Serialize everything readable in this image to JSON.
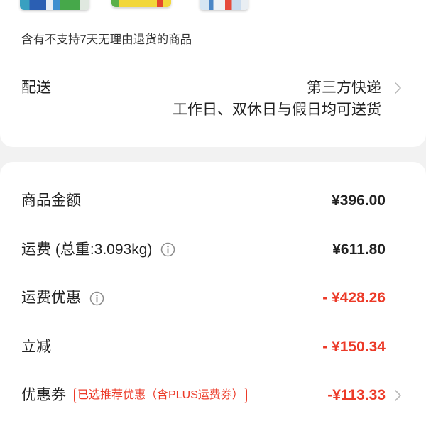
{
  "colors": {
    "accent_red": "#ec3a28",
    "text": "#222222",
    "icon_gray": "#8a8a8a",
    "chevron_gray": "#b8b8b8",
    "page_background": "#f2f2f2",
    "card_background": "#ffffff"
  },
  "products": {
    "notice": "含有不支持7天无理由退货的商品"
  },
  "delivery": {
    "label": "配送",
    "method": "第三方快递",
    "note": "工作日、双休日与假日均可送货",
    "icon": "chevron-right-icon"
  },
  "summary": {
    "rows": [
      {
        "label": "商品金额",
        "amount": "¥396.00"
      },
      {
        "label": "运费 (总重:3.093kg)",
        "amount": "¥611.80",
        "icon": "info-icon"
      },
      {
        "label": "运费优惠",
        "amount": "- ¥428.26",
        "icon": "info-icon"
      },
      {
        "label": "立减",
        "amount": "- ¥150.34"
      },
      {
        "label": "优惠券",
        "badge": "已选推荐优惠（含PLUS运费券）",
        "amount": "-¥113.33",
        "icon": "chevron-right-icon"
      }
    ]
  }
}
